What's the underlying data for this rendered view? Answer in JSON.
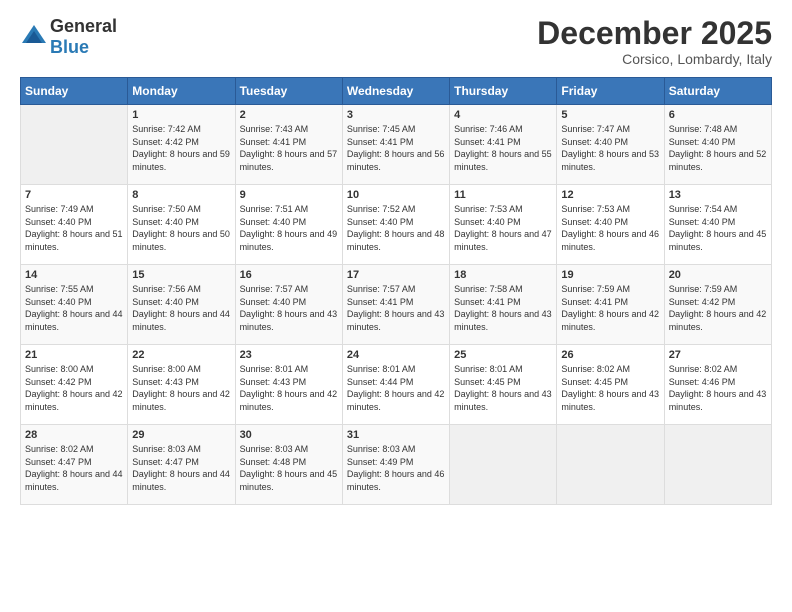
{
  "header": {
    "logo_general": "General",
    "logo_blue": "Blue",
    "month_title": "December 2025",
    "location": "Corsico, Lombardy, Italy"
  },
  "days_of_week": [
    "Sunday",
    "Monday",
    "Tuesday",
    "Wednesday",
    "Thursday",
    "Friday",
    "Saturday"
  ],
  "weeks": [
    [
      {
        "day": "",
        "sunrise": "",
        "sunset": "",
        "daylight": ""
      },
      {
        "day": "1",
        "sunrise": "Sunrise: 7:42 AM",
        "sunset": "Sunset: 4:42 PM",
        "daylight": "Daylight: 8 hours and 59 minutes."
      },
      {
        "day": "2",
        "sunrise": "Sunrise: 7:43 AM",
        "sunset": "Sunset: 4:41 PM",
        "daylight": "Daylight: 8 hours and 57 minutes."
      },
      {
        "day": "3",
        "sunrise": "Sunrise: 7:45 AM",
        "sunset": "Sunset: 4:41 PM",
        "daylight": "Daylight: 8 hours and 56 minutes."
      },
      {
        "day": "4",
        "sunrise": "Sunrise: 7:46 AM",
        "sunset": "Sunset: 4:41 PM",
        "daylight": "Daylight: 8 hours and 55 minutes."
      },
      {
        "day": "5",
        "sunrise": "Sunrise: 7:47 AM",
        "sunset": "Sunset: 4:40 PM",
        "daylight": "Daylight: 8 hours and 53 minutes."
      },
      {
        "day": "6",
        "sunrise": "Sunrise: 7:48 AM",
        "sunset": "Sunset: 4:40 PM",
        "daylight": "Daylight: 8 hours and 52 minutes."
      }
    ],
    [
      {
        "day": "7",
        "sunrise": "Sunrise: 7:49 AM",
        "sunset": "Sunset: 4:40 PM",
        "daylight": "Daylight: 8 hours and 51 minutes."
      },
      {
        "day": "8",
        "sunrise": "Sunrise: 7:50 AM",
        "sunset": "Sunset: 4:40 PM",
        "daylight": "Daylight: 8 hours and 50 minutes."
      },
      {
        "day": "9",
        "sunrise": "Sunrise: 7:51 AM",
        "sunset": "Sunset: 4:40 PM",
        "daylight": "Daylight: 8 hours and 49 minutes."
      },
      {
        "day": "10",
        "sunrise": "Sunrise: 7:52 AM",
        "sunset": "Sunset: 4:40 PM",
        "daylight": "Daylight: 8 hours and 48 minutes."
      },
      {
        "day": "11",
        "sunrise": "Sunrise: 7:53 AM",
        "sunset": "Sunset: 4:40 PM",
        "daylight": "Daylight: 8 hours and 47 minutes."
      },
      {
        "day": "12",
        "sunrise": "Sunrise: 7:53 AM",
        "sunset": "Sunset: 4:40 PM",
        "daylight": "Daylight: 8 hours and 46 minutes."
      },
      {
        "day": "13",
        "sunrise": "Sunrise: 7:54 AM",
        "sunset": "Sunset: 4:40 PM",
        "daylight": "Daylight: 8 hours and 45 minutes."
      }
    ],
    [
      {
        "day": "14",
        "sunrise": "Sunrise: 7:55 AM",
        "sunset": "Sunset: 4:40 PM",
        "daylight": "Daylight: 8 hours and 44 minutes."
      },
      {
        "day": "15",
        "sunrise": "Sunrise: 7:56 AM",
        "sunset": "Sunset: 4:40 PM",
        "daylight": "Daylight: 8 hours and 44 minutes."
      },
      {
        "day": "16",
        "sunrise": "Sunrise: 7:57 AM",
        "sunset": "Sunset: 4:40 PM",
        "daylight": "Daylight: 8 hours and 43 minutes."
      },
      {
        "day": "17",
        "sunrise": "Sunrise: 7:57 AM",
        "sunset": "Sunset: 4:41 PM",
        "daylight": "Daylight: 8 hours and 43 minutes."
      },
      {
        "day": "18",
        "sunrise": "Sunrise: 7:58 AM",
        "sunset": "Sunset: 4:41 PM",
        "daylight": "Daylight: 8 hours and 43 minutes."
      },
      {
        "day": "19",
        "sunrise": "Sunrise: 7:59 AM",
        "sunset": "Sunset: 4:41 PM",
        "daylight": "Daylight: 8 hours and 42 minutes."
      },
      {
        "day": "20",
        "sunrise": "Sunrise: 7:59 AM",
        "sunset": "Sunset: 4:42 PM",
        "daylight": "Daylight: 8 hours and 42 minutes."
      }
    ],
    [
      {
        "day": "21",
        "sunrise": "Sunrise: 8:00 AM",
        "sunset": "Sunset: 4:42 PM",
        "daylight": "Daylight: 8 hours and 42 minutes."
      },
      {
        "day": "22",
        "sunrise": "Sunrise: 8:00 AM",
        "sunset": "Sunset: 4:43 PM",
        "daylight": "Daylight: 8 hours and 42 minutes."
      },
      {
        "day": "23",
        "sunrise": "Sunrise: 8:01 AM",
        "sunset": "Sunset: 4:43 PM",
        "daylight": "Daylight: 8 hours and 42 minutes."
      },
      {
        "day": "24",
        "sunrise": "Sunrise: 8:01 AM",
        "sunset": "Sunset: 4:44 PM",
        "daylight": "Daylight: 8 hours and 42 minutes."
      },
      {
        "day": "25",
        "sunrise": "Sunrise: 8:01 AM",
        "sunset": "Sunset: 4:45 PM",
        "daylight": "Daylight: 8 hours and 43 minutes."
      },
      {
        "day": "26",
        "sunrise": "Sunrise: 8:02 AM",
        "sunset": "Sunset: 4:45 PM",
        "daylight": "Daylight: 8 hours and 43 minutes."
      },
      {
        "day": "27",
        "sunrise": "Sunrise: 8:02 AM",
        "sunset": "Sunset: 4:46 PM",
        "daylight": "Daylight: 8 hours and 43 minutes."
      }
    ],
    [
      {
        "day": "28",
        "sunrise": "Sunrise: 8:02 AM",
        "sunset": "Sunset: 4:47 PM",
        "daylight": "Daylight: 8 hours and 44 minutes."
      },
      {
        "day": "29",
        "sunrise": "Sunrise: 8:03 AM",
        "sunset": "Sunset: 4:47 PM",
        "daylight": "Daylight: 8 hours and 44 minutes."
      },
      {
        "day": "30",
        "sunrise": "Sunrise: 8:03 AM",
        "sunset": "Sunset: 4:48 PM",
        "daylight": "Daylight: 8 hours and 45 minutes."
      },
      {
        "day": "31",
        "sunrise": "Sunrise: 8:03 AM",
        "sunset": "Sunset: 4:49 PM",
        "daylight": "Daylight: 8 hours and 46 minutes."
      },
      {
        "day": "",
        "sunrise": "",
        "sunset": "",
        "daylight": ""
      },
      {
        "day": "",
        "sunrise": "",
        "sunset": "",
        "daylight": ""
      },
      {
        "day": "",
        "sunrise": "",
        "sunset": "",
        "daylight": ""
      }
    ]
  ]
}
